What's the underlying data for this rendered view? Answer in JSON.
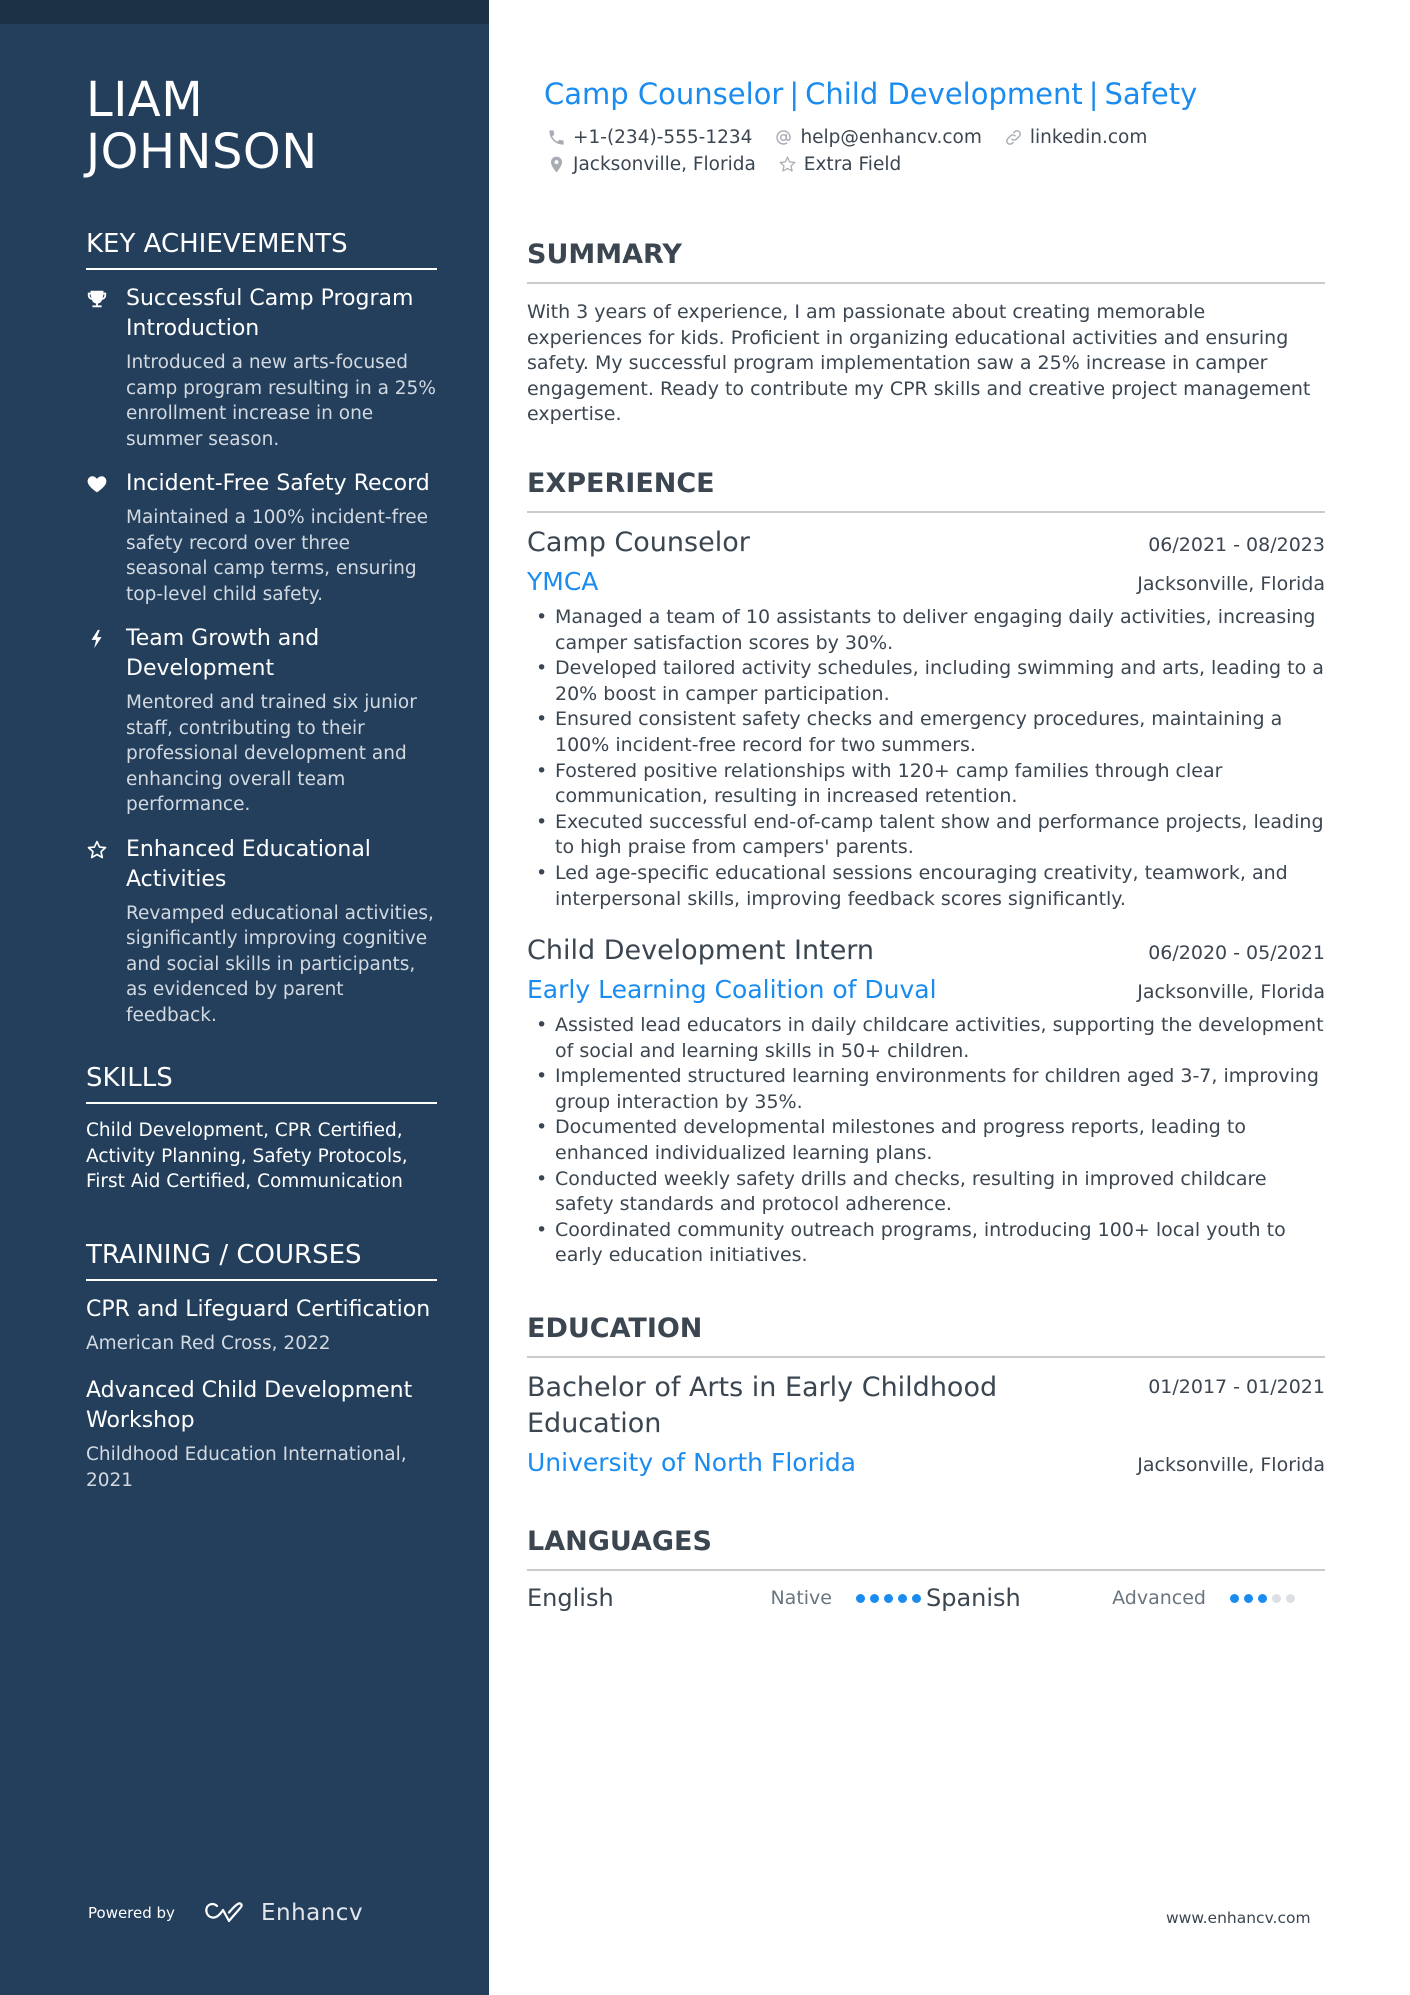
{
  "sidebar": {
    "name_line1": "LIAM",
    "name_line2": "JOHNSON",
    "achievements_title": "KEY ACHIEVEMENTS",
    "achievements": [
      {
        "icon": "trophy-icon",
        "title": "Successful Camp Program Introduction",
        "desc": "Introduced a new arts-focused camp program resulting in a 25% enrollment increase in one summer season."
      },
      {
        "icon": "heart-icon",
        "title": "Incident-Free Safety Record",
        "desc": "Maintained a 100% incident-free safety record over three seasonal camp terms, ensuring top-level child safety."
      },
      {
        "icon": "lightning-bolt-icon",
        "title": "Team Growth and Development",
        "desc": "Mentored and trained six junior staff, contributing to their professional development and enhancing overall team performance."
      },
      {
        "icon": "star-icon",
        "title": "Enhanced Educational Activities",
        "desc": "Revamped educational activities, significantly improving cognitive and social skills in participants, as evidenced by parent feedback."
      }
    ],
    "skills_title": "SKILLS",
    "skills_text": "Child Development, CPR Certified, Activity Planning, Safety Protocols, First Aid Certified, Communication",
    "training_title": "TRAINING / COURSES",
    "courses": [
      {
        "title": "CPR and Lifeguard Certification",
        "org": "American Red Cross, 2022"
      },
      {
        "title": "Advanced Child Development Workshop",
        "org": "Childhood Education International, 2021"
      }
    ],
    "powered_by": "Powered by",
    "brand": "Enhancv"
  },
  "header": {
    "headline_parts": [
      "Camp Counselor",
      "Child Development",
      "Safety"
    ],
    "separator": "|",
    "phone": "+1-(234)-555-1234",
    "email": "help@enhancv.com",
    "linkedin": "linkedin.com",
    "location": "Jacksonville, Florida",
    "extra": "Extra Field"
  },
  "summary": {
    "title": "SUMMARY",
    "text": "With 3 years of experience, I am passionate about creating memorable experiences for kids. Proficient in organizing educational activities and ensuring safety. My successful program implementation saw a 25% increase in camper engagement. Ready to contribute my CPR skills and creative project management expertise."
  },
  "experience": {
    "title": "EXPERIENCE",
    "jobs": [
      {
        "title": "Camp Counselor",
        "dates": "06/2021 - 08/2023",
        "company": "YMCA",
        "location": "Jacksonville, Florida",
        "bullets": [
          "Managed a team of 10 assistants to deliver engaging daily activities, increasing camper satisfaction scores by 30%.",
          "Developed tailored activity schedules, including swimming and arts, leading to a 20% boost in camper participation.",
          "Ensured consistent safety checks and emergency procedures, maintaining a 100% incident-free record for two summers.",
          "Fostered positive relationships with 120+ camp families through clear communication, resulting in increased retention.",
          "Executed successful end-of-camp talent show and performance projects, leading to high praise from campers' parents.",
          "Led age-specific educational sessions encouraging creativity, teamwork, and interpersonal skills, improving feedback scores significantly."
        ]
      },
      {
        "title": "Child Development Intern",
        "dates": "06/2020 - 05/2021",
        "company": "Early Learning Coalition of Duval",
        "location": "Jacksonville, Florida",
        "bullets": [
          "Assisted lead educators in daily childcare activities, supporting the development of social and learning skills in 50+ children.",
          "Implemented structured learning environments for children aged 3-7, improving group interaction by 35%.",
          "Documented developmental milestones and progress reports, leading to enhanced individualized learning plans.",
          "Conducted weekly safety drills and checks, resulting in improved childcare safety standards and protocol adherence.",
          "Coordinated community outreach programs, introducing 100+ local youth to early education initiatives."
        ]
      }
    ]
  },
  "education": {
    "title": "EDUCATION",
    "degree": "Bachelor of Arts in Early Childhood Education",
    "dates": "01/2017 - 01/2021",
    "school": "University of North Florida",
    "location": "Jacksonville, Florida"
  },
  "languages": {
    "title": "LANGUAGES",
    "items": [
      {
        "name": "English",
        "level": "Native",
        "rating": 5,
        "max": 5
      },
      {
        "name": "Spanish",
        "level": "Advanced",
        "rating": 3,
        "max": 5
      }
    ]
  },
  "footer": {
    "website": "www.enhancv.com"
  },
  "colors": {
    "sidebar_bg": "#233f5c",
    "accent": "#1a8cf0",
    "text": "#3b4650"
  }
}
